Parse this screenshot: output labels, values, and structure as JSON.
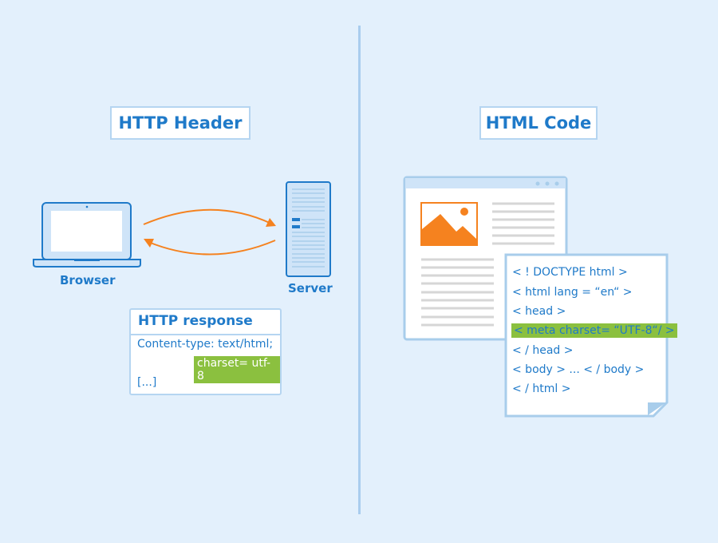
{
  "left_panel": {
    "title": "HTTP Header",
    "browser_label": "Browser",
    "server_label": "Server",
    "response_box": {
      "title": "HTTP response",
      "lines": [
        "Content-type: text/html;",
        "charset= utf-8",
        "[...]"
      ],
      "highlighted_line": "charset= utf-8"
    }
  },
  "right_panel": {
    "title": "HTML Code",
    "code_lines": [
      "< ! DOCTYPE html >",
      "< html lang = “en“ >",
      "< head >",
      "< meta charset= “UTF-8“/ >",
      "< / head >",
      "< body > ... < / body >",
      "< / html >"
    ],
    "highlighted_line_index": 3
  },
  "colors": {
    "background": "#e3f0fc",
    "primary_blue": "#1f7ac9",
    "border_blue": "#b5d5f1",
    "arrow_orange": "#f5821f",
    "highlight_green": "#8bc03f"
  }
}
